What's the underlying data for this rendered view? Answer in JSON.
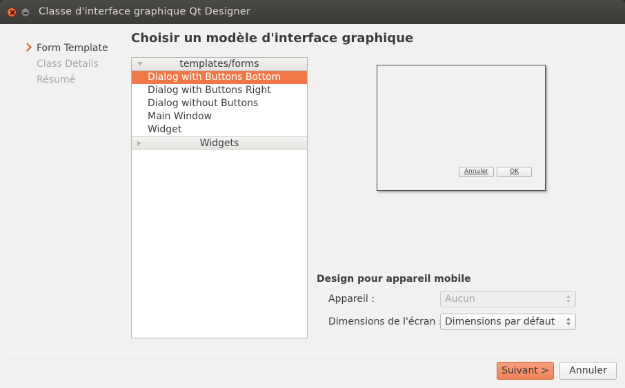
{
  "window": {
    "title": "Classe d'interface graphique Qt Designer"
  },
  "steps": [
    {
      "label": "Form Template",
      "active": true
    },
    {
      "label": "Class Details",
      "active": false
    },
    {
      "label": "Résumé",
      "active": false
    }
  ],
  "heading": "Choisir un modèle d'interface graphique",
  "tree": {
    "group1": {
      "label": "templates/forms",
      "expanded": true,
      "items": [
        "Dialog with Buttons Bottom",
        "Dialog with Buttons Right",
        "Dialog without Buttons",
        "Main Window",
        "Widget"
      ],
      "selected_index": 0
    },
    "group2": {
      "label": "Widgets",
      "expanded": false
    }
  },
  "preview": {
    "cancel_label": "Annuler",
    "ok_label": "OK"
  },
  "mobile": {
    "title": "Design pour appareil mobile",
    "device_label": "Appareil :",
    "device_value": "Aucun",
    "screen_label": "Dimensions de l'écran :",
    "screen_value": "Dimensions par défaut"
  },
  "buttons": {
    "next_label": "Suivant >",
    "cancel_label": "Annuler"
  },
  "colors": {
    "accent": "#f07746",
    "titlebar": "#3c3b37",
    "background": "#f2f1f0"
  }
}
